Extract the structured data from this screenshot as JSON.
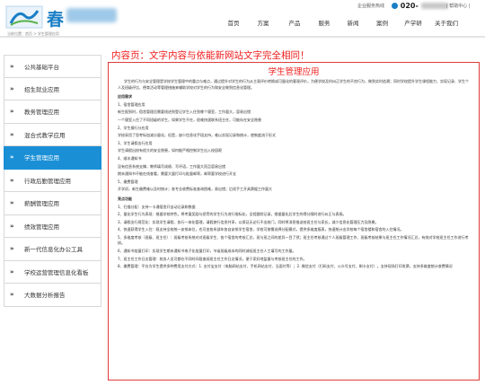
{
  "header": {
    "logo_text": "春",
    "top_info": "企业服务热线",
    "phone_prefix": "020-",
    "top_links": "| 帮助中心 |",
    "breadcrumb": "当前位置：首页 > 学生管理应用",
    "nav": [
      "首页",
      "方案",
      "产品",
      "服务",
      "新闻",
      "案例",
      "产学研",
      "关于我们"
    ]
  },
  "sidebar": {
    "items": [
      {
        "label": "公共基础平台"
      },
      {
        "label": "招生就业应用"
      },
      {
        "label": "教务管理应用"
      },
      {
        "label": "混合式教学应用"
      },
      {
        "label": "学生管理应用",
        "active": true
      },
      {
        "label": "行政后勤管理应用"
      },
      {
        "label": "薪酬管理应用"
      },
      {
        "label": "绩效管理应用"
      },
      {
        "label": "新一代信息化办公工具"
      },
      {
        "label": "学校运营管理信息化看板"
      },
      {
        "label": "大数据分析报告"
      }
    ]
  },
  "main": {
    "note": "内容页：文字内容与依能新网站文字完全相同！",
    "title": "学生管理应用",
    "intro": "学生的行为与安全管理是学校学生管理中的重点与难点，通过提升对学生的行为从主观评价转换成可量化的客观评价，为便学校及时纠正学生的不良行为，做到实时追溯；同时学校提升学生课程能力、实现记录、学生个人及班级评比、德育活动等管理措施来辅助学校对学生的行为和安全做到信息化管理。",
    "section1": "应用需求",
    "items1": [
      "1、宿舍管理应用",
      "新生报到时，宿舍管理员需要线进到登记学生入住到哪个寝室，工作量大，容易出错",
      "一个寝室入住了不同班级的学生，如果学生不在，很难快速联系班主任，可能存在安全隐患",
      "2、学生操行分应用",
      "学校采用了思考标加减分量化，但是，缺少信息化手段支持，难以实现记录和统计，使制度流于形式",
      "3、学生请假出行应用",
      "学生请假出校有很大的安全隐患，如何能严格控制学生出入校园呢",
      "4、顺丰通知书",
      "没有信息系统支撑，教师填写成绩、写评语，工作量大而且容易出错",
      "期末通知书不能在线查看，需要大量打印与批量邮寄，邮寄要学校进行开支",
      "5、缴费管理",
      "开学初，新生缴费难以及时统计；各专业收费标准查询困难，易出错；后续手工开具票据工作量大"
    ],
    "section2": "亮点功能",
    "items2": [
      "1、扫描分配：支持一卡通宿舍开自动记录和数据",
      "2、量化学生行为表现：根据学校特色，将考量奖励与惩罚的学生行为进行指标化，全程跟踪记录，根据量化后学生的得分随时进行纠正与表扬。",
      "3、请假出行规范化：实现学生请假、执行一体化管理，请假旅行信息共享，以保证无论行不出校门，同时将消息推送给班主任与家长，减少信息化管理压力及隐患。",
      "4、快速获得学生入住：既支持全校统一安排床位，也可由各系部年各自安排学生宿舍，学校可按需选择分配模式，提供多维度报表，快速统计出学校每个宿舍楼和宿舍的入住情况。",
      "5、多维度考核（班级、班主任）：班级考核系统对对班级学生、各个宿舍的考核汇总，班与班之间的差异一目了然；班主任考核通过个人班级管理工作、班级考核结果与班主任工作情况汇总，有效对学校班主任工作进行考核。",
      "6、通知书批量打印：实现学生期末通知书电子化批量打印，节省班级成本的同时减轻班主任人工填写的工作量。",
      "7、班主任工作日志管理：校务人员可都在不同时间段查阅班主任工作日志情况，便于家好地监督与考核班主任的工作。",
      "8、缴费管理：平台为学生提供多种费用支付方式：1. 支付宝支付（电脑网站支付、手机网站支付、当面付等）；2. 微信支付（扫码支付、公众号支付、刷卡支付）。支持现场打印发票，支持多维度统计收费情况"
    ]
  }
}
